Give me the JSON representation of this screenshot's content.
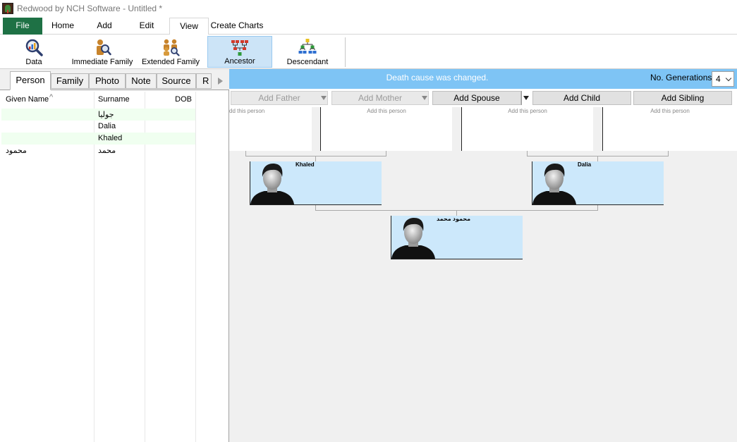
{
  "window": {
    "title": "Redwood by NCH Software - Untitled *"
  },
  "menu": {
    "file": "File",
    "home": "Home",
    "add": "Add",
    "edit": "Edit",
    "view": "View",
    "create_charts": "Create Charts"
  },
  "ribbon": {
    "data": "Data",
    "immediate_family": "Immediate Family",
    "extended_family": "Extended Family",
    "ancestor": "Ancestor",
    "descendant": "Descendant"
  },
  "left_tabs": {
    "person": "Person",
    "family": "Family",
    "photo": "Photo",
    "note": "Note",
    "source": "Source",
    "r": "R"
  },
  "table": {
    "headers": {
      "given_name": "Given Name",
      "surname": "Surname",
      "dob": "DOB"
    },
    "rows": [
      {
        "given": "",
        "surname": "جوليا",
        "dob": ""
      },
      {
        "given": "",
        "surname": "Dalia",
        "dob": ""
      },
      {
        "given": "",
        "surname": "Khaled",
        "dob": ""
      },
      {
        "given": "محمود",
        "surname": "محمد",
        "dob": ""
      }
    ]
  },
  "status": {
    "message": "Death cause was changed.",
    "generations_label": "No. Generations:",
    "generations_value": "4"
  },
  "actions": {
    "add_father": "Add Father",
    "add_mother": "Add Mother",
    "add_spouse": "Add Spouse",
    "add_child": "Add Child",
    "add_sibling": "Add Sibling"
  },
  "tree": {
    "add_hint": "Add this person",
    "add_hint_cut": "dd this person",
    "people": {
      "khaled": "Khaled",
      "dalia": "Dalia",
      "mahmoud": "محمود محمد"
    }
  },
  "colors": {
    "file_tab": "#1e7145",
    "status_bar": "#7ec4f5",
    "card_bg": "#cce8fb",
    "ancestor_selected": "#cce4f7"
  }
}
